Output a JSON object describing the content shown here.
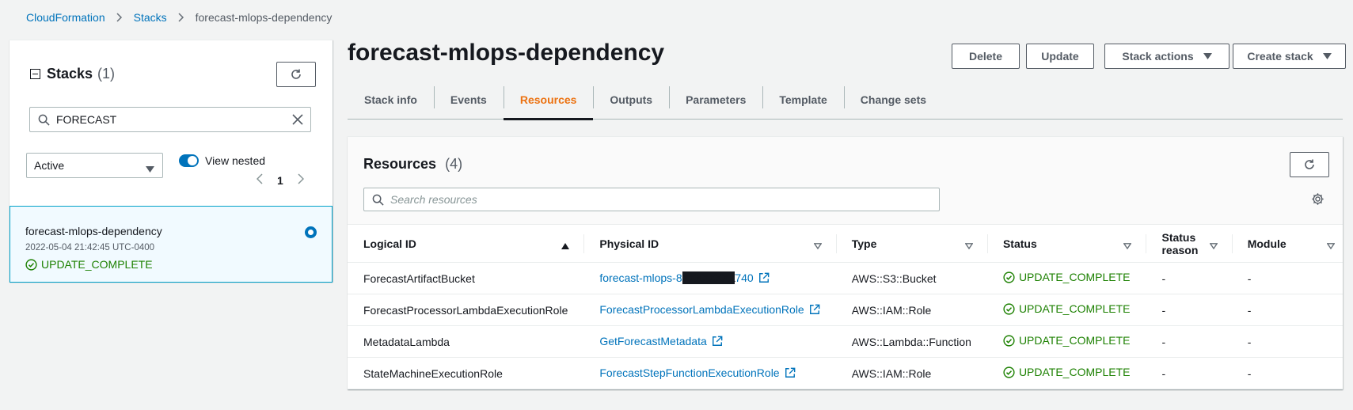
{
  "breadcrumb": {
    "root": "CloudFormation",
    "stacks": "Stacks",
    "current": "forecast-mlops-dependency"
  },
  "stacks_panel": {
    "title": "Stacks",
    "count": "(1)",
    "search_value": "FORECAST",
    "filter_value": "Active",
    "view_nested_label": "View nested",
    "page": "1",
    "items": [
      {
        "name": "forecast-mlops-dependency",
        "time": "2022-05-04 21:42:45 UTC-0400",
        "status": "UPDATE_COMPLETE"
      }
    ]
  },
  "header": {
    "title": "forecast-mlops-dependency",
    "buttons": {
      "delete": "Delete",
      "update": "Update",
      "stack_actions": "Stack actions",
      "create_stack": "Create stack"
    }
  },
  "tabs": [
    "Stack info",
    "Events",
    "Resources",
    "Outputs",
    "Parameters",
    "Template",
    "Change sets"
  ],
  "resources": {
    "title": "Resources",
    "count": "(4)",
    "search_placeholder": "Search resources",
    "columns": [
      "Logical ID",
      "Physical ID",
      "Type",
      "Status",
      "Status reason",
      "Module"
    ],
    "rows": [
      {
        "logical_id": "ForecastArtifactBucket",
        "physical_id_prefix": "forecast-mlops-8",
        "physical_id_redacted": "XXXXXXXX",
        "physical_id_suffix": "740",
        "type": "AWS::S3::Bucket",
        "status": "UPDATE_COMPLETE",
        "reason": "-",
        "module": "-"
      },
      {
        "logical_id": "ForecastProcessorLambdaExecutionRole",
        "physical_id": "ForecastProcessorLambdaExecutionRole",
        "type": "AWS::IAM::Role",
        "status": "UPDATE_COMPLETE",
        "reason": "-",
        "module": "-"
      },
      {
        "logical_id": "MetadataLambda",
        "physical_id": "GetForecastMetadata",
        "type": "AWS::Lambda::Function",
        "status": "UPDATE_COMPLETE",
        "reason": "-",
        "module": "-"
      },
      {
        "logical_id": "StateMachineExecutionRole",
        "physical_id": "ForecastStepFunctionExecutionRole",
        "type": "AWS::IAM::Role",
        "status": "UPDATE_COMPLETE",
        "reason": "-",
        "module": "-"
      }
    ]
  },
  "colors": {
    "link": "#0073bb",
    "success": "#1d8102",
    "active_tab": "#ec7211"
  }
}
